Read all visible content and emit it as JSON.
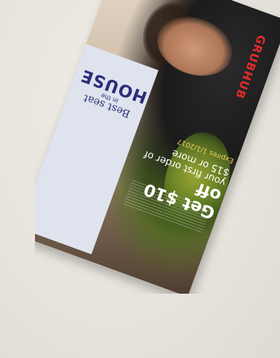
{
  "card": {
    "brand": "GRUBHUB",
    "tagline": {
      "line1": "Best seat",
      "line2": "in the",
      "line3": "HOUSE"
    },
    "offer": {
      "headline": "Get $10 off",
      "line1": "your first order of",
      "line2": "$15 or more",
      "expires": "Expires 1/1/2017"
    }
  },
  "colors": {
    "brand_red": "#e52b2b",
    "tagline_navy": "#2b2f7a",
    "offer_white": "#ffffff",
    "expires_yellow": "#f2d25a"
  }
}
